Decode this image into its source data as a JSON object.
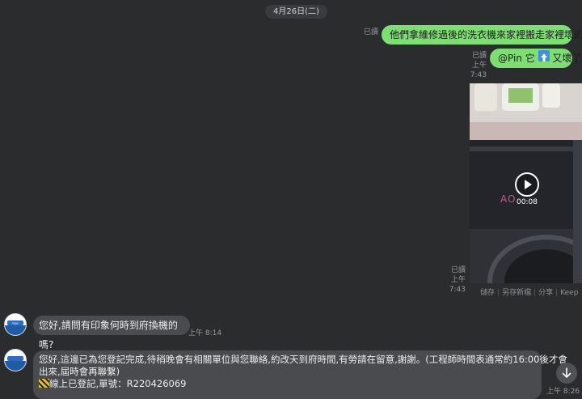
{
  "date_divider": "4月26日(二)",
  "messages": {
    "m1": {
      "text": "他們拿維修過後的洗衣機來家裡搬走家裡壞的",
      "read": "已讀"
    },
    "m2": {
      "mention": "@Pin",
      "text_after": "又壞了",
      "read": "已讀",
      "time": "上午 7:43"
    },
    "video": {
      "duration": "00:08",
      "display_code": "AO",
      "read": "已讀",
      "time": "上午 7:43"
    },
    "m3": {
      "text": "您好,請問有印象何時到府換機的嗎?",
      "time": "上午 8:14"
    },
    "m4": {
      "line1": "您好,這邊已為您登記完成,待稍晚會有相關單位與您聯絡,約改天到府時間,有勞請在留意,謝謝。(工程師時間表通常約16:00後才會",
      "line2": "出來,屆時會再聯繫)",
      "line3": "線上已登記,單號：R220426069",
      "time": "上午 8:26"
    }
  },
  "video_actions": [
    "儲存",
    "另存新檔",
    "分享",
    "Keep"
  ],
  "icons": {
    "play": "play-icon",
    "up_arrow": "up-arrow-emoji-icon",
    "down_arrow": "scroll-down-icon",
    "warning": "hazard-stripes-icon"
  },
  "colors": {
    "outgoing_bubble": "#7dde72",
    "incoming_bubble": "#4a4b4e",
    "background": "#2b2c2e"
  }
}
